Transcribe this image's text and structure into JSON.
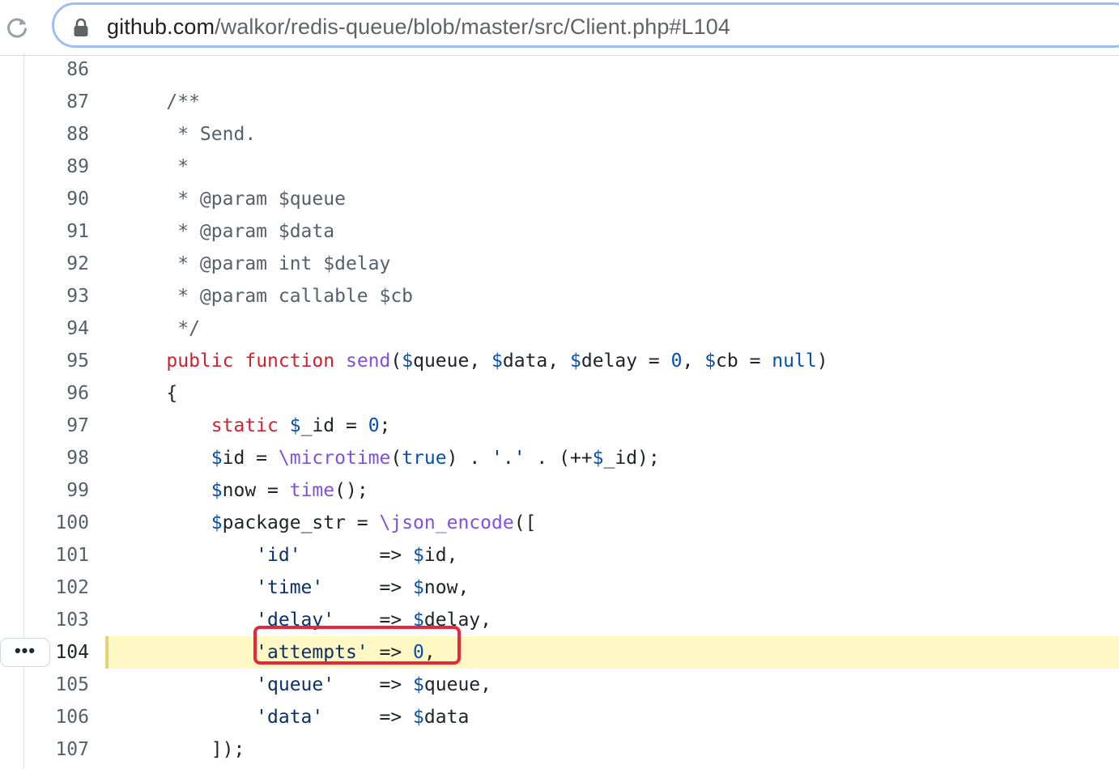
{
  "browser": {
    "url_host": "github.com",
    "url_path": "/walkor/redis-queue/blob/master/src/Client.php#L104"
  },
  "code": {
    "highlighted_line": 104,
    "more_button_label": "•••",
    "lines": [
      {
        "n": "86",
        "tokens": []
      },
      {
        "n": "87",
        "tokens": [
          {
            "t": "    /**",
            "c": "comment"
          }
        ]
      },
      {
        "n": "88",
        "tokens": [
          {
            "t": "     * Send.",
            "c": "comment"
          }
        ]
      },
      {
        "n": "89",
        "tokens": [
          {
            "t": "     *",
            "c": "comment"
          }
        ]
      },
      {
        "n": "90",
        "tokens": [
          {
            "t": "     * @param $queue",
            "c": "comment"
          }
        ]
      },
      {
        "n": "91",
        "tokens": [
          {
            "t": "     * @param $data",
            "c": "comment"
          }
        ]
      },
      {
        "n": "92",
        "tokens": [
          {
            "t": "     * @param int $delay",
            "c": "comment"
          }
        ]
      },
      {
        "n": "93",
        "tokens": [
          {
            "t": "     * @param callable $cb",
            "c": "comment"
          }
        ]
      },
      {
        "n": "94",
        "tokens": [
          {
            "t": "     */",
            "c": "comment"
          }
        ]
      },
      {
        "n": "95",
        "tokens": [
          {
            "t": "    ",
            "c": "pl"
          },
          {
            "t": "public",
            "c": "kw"
          },
          {
            "t": " ",
            "c": "pl"
          },
          {
            "t": "function",
            "c": "kw"
          },
          {
            "t": " ",
            "c": "pl"
          },
          {
            "t": "send",
            "c": "fn"
          },
          {
            "t": "(",
            "c": "pl"
          },
          {
            "t": "$",
            "c": "var"
          },
          {
            "t": "queue, ",
            "c": "pl"
          },
          {
            "t": "$",
            "c": "var"
          },
          {
            "t": "data, ",
            "c": "pl"
          },
          {
            "t": "$",
            "c": "var"
          },
          {
            "t": "delay = ",
            "c": "pl"
          },
          {
            "t": "0",
            "c": "num"
          },
          {
            "t": ", ",
            "c": "pl"
          },
          {
            "t": "$",
            "c": "var"
          },
          {
            "t": "cb = ",
            "c": "pl"
          },
          {
            "t": "null",
            "c": "var"
          },
          {
            "t": ")",
            "c": "pl"
          }
        ]
      },
      {
        "n": "96",
        "tokens": [
          {
            "t": "    {",
            "c": "pl"
          }
        ]
      },
      {
        "n": "97",
        "tokens": [
          {
            "t": "        ",
            "c": "pl"
          },
          {
            "t": "static",
            "c": "kw"
          },
          {
            "t": " ",
            "c": "pl"
          },
          {
            "t": "$",
            "c": "var"
          },
          {
            "t": "_id = ",
            "c": "pl"
          },
          {
            "t": "0",
            "c": "num"
          },
          {
            "t": ";",
            "c": "pl"
          }
        ]
      },
      {
        "n": "98",
        "tokens": [
          {
            "t": "        ",
            "c": "pl"
          },
          {
            "t": "$",
            "c": "var"
          },
          {
            "t": "id = ",
            "c": "pl"
          },
          {
            "t": "\\microtime",
            "c": "fn"
          },
          {
            "t": "(",
            "c": "pl"
          },
          {
            "t": "true",
            "c": "var"
          },
          {
            "t": ") . ",
            "c": "pl"
          },
          {
            "t": "'.'",
            "c": "str"
          },
          {
            "t": " . (++",
            "c": "pl"
          },
          {
            "t": "$",
            "c": "var"
          },
          {
            "t": "_id);",
            "c": "pl"
          }
        ]
      },
      {
        "n": "99",
        "tokens": [
          {
            "t": "        ",
            "c": "pl"
          },
          {
            "t": "$",
            "c": "var"
          },
          {
            "t": "now = ",
            "c": "pl"
          },
          {
            "t": "time",
            "c": "fn"
          },
          {
            "t": "();",
            "c": "pl"
          }
        ]
      },
      {
        "n": "100",
        "tokens": [
          {
            "t": "        ",
            "c": "pl"
          },
          {
            "t": "$",
            "c": "var"
          },
          {
            "t": "package_str = ",
            "c": "pl"
          },
          {
            "t": "\\json_encode",
            "c": "fn"
          },
          {
            "t": "([",
            "c": "pl"
          }
        ]
      },
      {
        "n": "101",
        "tokens": [
          {
            "t": "            ",
            "c": "pl"
          },
          {
            "t": "'id'",
            "c": "str"
          },
          {
            "t": "       => ",
            "c": "pl"
          },
          {
            "t": "$",
            "c": "var"
          },
          {
            "t": "id,",
            "c": "pl"
          }
        ]
      },
      {
        "n": "102",
        "tokens": [
          {
            "t": "            ",
            "c": "pl"
          },
          {
            "t": "'time'",
            "c": "str"
          },
          {
            "t": "     => ",
            "c": "pl"
          },
          {
            "t": "$",
            "c": "var"
          },
          {
            "t": "now,",
            "c": "pl"
          }
        ]
      },
      {
        "n": "103",
        "tokens": [
          {
            "t": "            ",
            "c": "pl"
          },
          {
            "t": "'delay'",
            "c": "str"
          },
          {
            "t": "    => ",
            "c": "pl"
          },
          {
            "t": "$",
            "c": "var"
          },
          {
            "t": "delay,",
            "c": "pl"
          }
        ]
      },
      {
        "n": "104",
        "tokens": [
          {
            "t": "            ",
            "c": "pl"
          },
          {
            "t": "'attempts'",
            "c": "str"
          },
          {
            "t": " => ",
            "c": "pl"
          },
          {
            "t": "0",
            "c": "num"
          },
          {
            "t": ",",
            "c": "pl"
          }
        ]
      },
      {
        "n": "105",
        "tokens": [
          {
            "t": "            ",
            "c": "pl"
          },
          {
            "t": "'queue'",
            "c": "str"
          },
          {
            "t": "    => ",
            "c": "pl"
          },
          {
            "t": "$",
            "c": "var"
          },
          {
            "t": "queue,",
            "c": "pl"
          }
        ]
      },
      {
        "n": "106",
        "tokens": [
          {
            "t": "            ",
            "c": "pl"
          },
          {
            "t": "'data'",
            "c": "str"
          },
          {
            "t": "     => ",
            "c": "pl"
          },
          {
            "t": "$",
            "c": "var"
          },
          {
            "t": "data",
            "c": "pl"
          }
        ]
      },
      {
        "n": "107",
        "tokens": [
          {
            "t": "        ]);",
            "c": "pl"
          }
        ]
      }
    ]
  }
}
